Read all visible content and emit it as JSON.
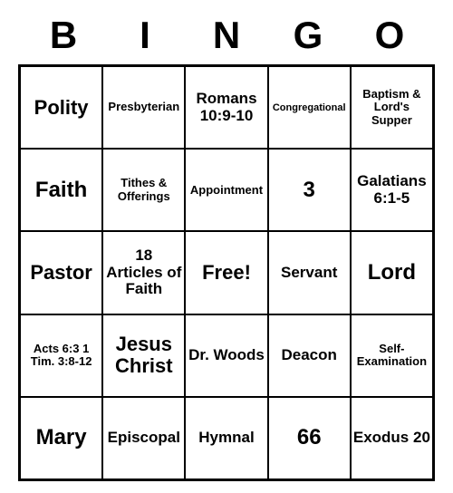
{
  "header": [
    "B",
    "I",
    "N",
    "G",
    "O"
  ],
  "cells": [
    {
      "text": "Polity",
      "size": "fs-lg"
    },
    {
      "text": "Presbyterian",
      "size": "fs-sm"
    },
    {
      "text": "Romans 10:9-10",
      "size": "fs-md"
    },
    {
      "text": "Congregational",
      "size": "fs-xs"
    },
    {
      "text": "Baptism & Lord's Supper",
      "size": "fs-sm"
    },
    {
      "text": "Faith",
      "size": "fs-xl"
    },
    {
      "text": "Tithes & Offerings",
      "size": "fs-sm"
    },
    {
      "text": "Appointment",
      "size": "fs-sm"
    },
    {
      "text": "3",
      "size": "fs-xl"
    },
    {
      "text": "Galatians 6:1-5",
      "size": "fs-md"
    },
    {
      "text": "Pastor",
      "size": "fs-lg"
    },
    {
      "text": "18 Articles of Faith",
      "size": "fs-md"
    },
    {
      "text": "Free!",
      "size": "fs-lg"
    },
    {
      "text": "Servant",
      "size": "fs-md"
    },
    {
      "text": "Lord",
      "size": "fs-xl"
    },
    {
      "text": "Acts 6:3 1 Tim. 3:8-12",
      "size": "fs-sm"
    },
    {
      "text": "Jesus Christ",
      "size": "fs-lg"
    },
    {
      "text": "Dr. Woods",
      "size": "fs-md"
    },
    {
      "text": "Deacon",
      "size": "fs-md"
    },
    {
      "text": "Self-Examination",
      "size": "fs-sm"
    },
    {
      "text": "Mary",
      "size": "fs-xl"
    },
    {
      "text": "Episcopal",
      "size": "fs-md"
    },
    {
      "text": "Hymnal",
      "size": "fs-md"
    },
    {
      "text": "66",
      "size": "fs-xl"
    },
    {
      "text": "Exodus 20",
      "size": "fs-md"
    }
  ]
}
